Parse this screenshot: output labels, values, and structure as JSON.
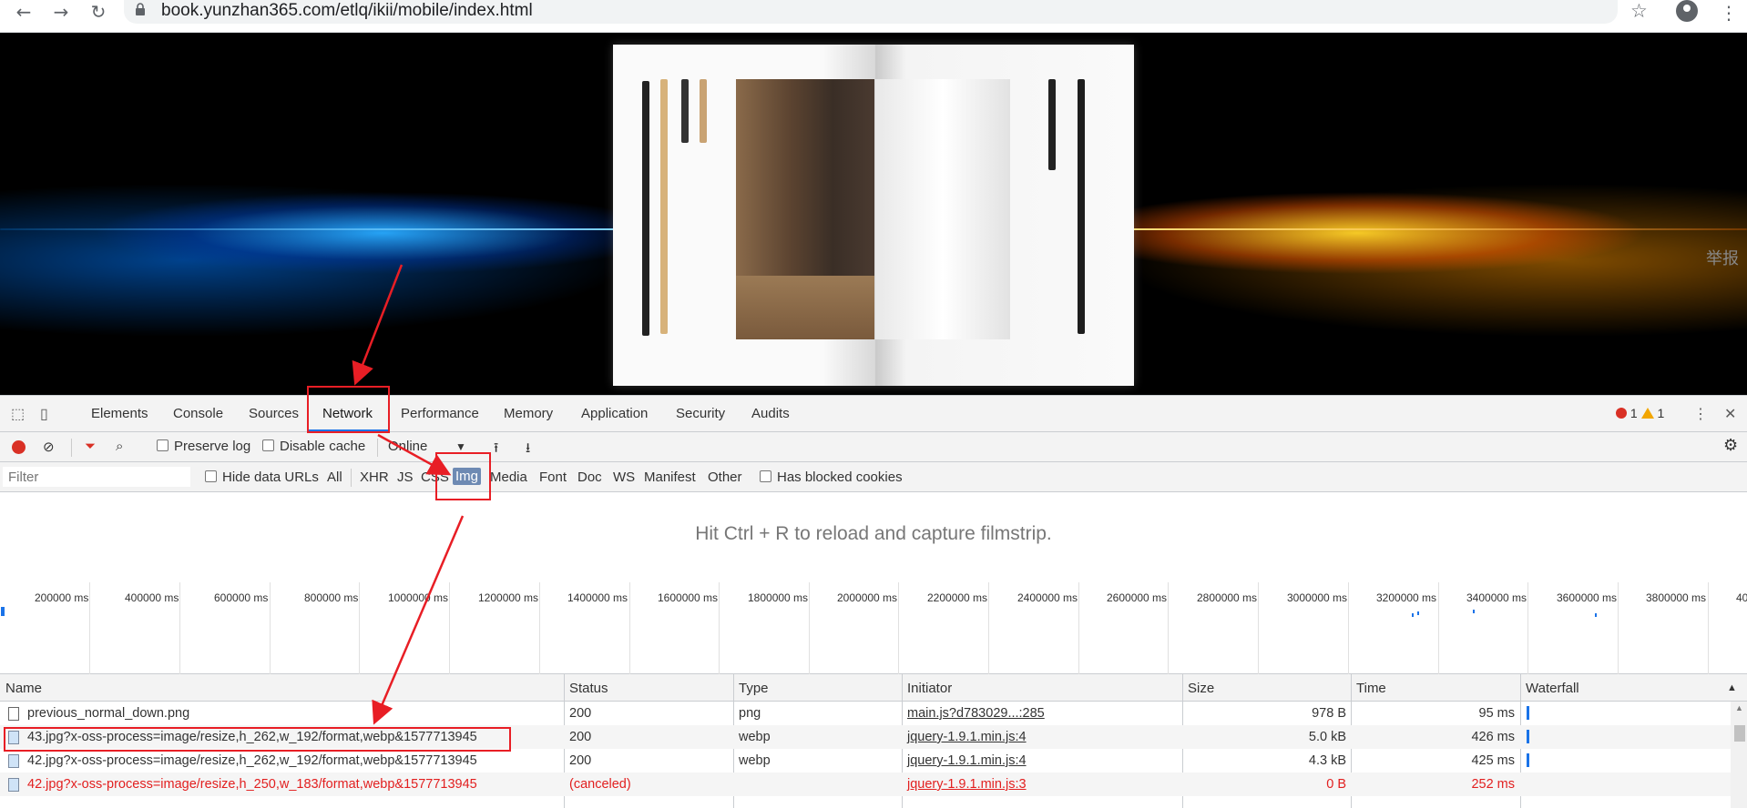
{
  "browser": {
    "url": "book.yunzhan365.com/etlq/ikii/mobile/index.html",
    "icons": [
      "back-icon",
      "forward-icon",
      "reload-icon",
      "lock-icon",
      "star-icon",
      "account-icon"
    ]
  },
  "page": {
    "report_label": "举报"
  },
  "devtools": {
    "tabs": [
      "Elements",
      "Console",
      "Sources",
      "Network",
      "Performance",
      "Memory",
      "Application",
      "Security",
      "Audits"
    ],
    "active_tab": "Network",
    "error_count": "1",
    "warning_count": "1",
    "toolbar": {
      "preserve_log": "Preserve log",
      "disable_cache": "Disable cache",
      "throttle": "Online"
    },
    "filter": {
      "placeholder": "Filter",
      "hide_data_urls": "Hide data URLs",
      "types": [
        "All",
        "XHR",
        "JS",
        "CSS",
        "Img",
        "Media",
        "Font",
        "Doc",
        "WS",
        "Manifest",
        "Other"
      ],
      "selected_type": "Img",
      "has_blocked_cookies": "Has blocked cookies"
    },
    "filmstrip_message": "Hit Ctrl + R to reload and capture filmstrip.",
    "timeline_ticks": [
      "200000 ms",
      "400000 ms",
      "600000 ms",
      "800000 ms",
      "1000000 ms",
      "1200000 ms",
      "1400000 ms",
      "1600000 ms",
      "1800000 ms",
      "2000000 ms",
      "2200000 ms",
      "2400000 ms",
      "2600000 ms",
      "2800000 ms",
      "3000000 ms",
      "3200000 ms",
      "3400000 ms",
      "3600000 ms",
      "3800000 ms",
      "40"
    ],
    "columns": [
      "Name",
      "Status",
      "Type",
      "Initiator",
      "Size",
      "Time",
      "Waterfall"
    ],
    "rows": [
      {
        "name": "previous_normal_down.png",
        "status": "200",
        "type": "png",
        "initiator": "main.js?d783029...:285",
        "size": "978 B",
        "time": "95 ms"
      },
      {
        "name": "43.jpg?x-oss-process=image/resize,h_262,w_192/format,webp&1577713945",
        "status": "200",
        "type": "webp",
        "initiator": "jquery-1.9.1.min.js:4",
        "size": "5.0 kB",
        "time": "426 ms"
      },
      {
        "name": "42.jpg?x-oss-process=image/resize,h_262,w_192/format,webp&1577713945",
        "status": "200",
        "type": "webp",
        "initiator": "jquery-1.9.1.min.js:4",
        "size": "4.3 kB",
        "time": "425 ms"
      },
      {
        "name": "42.jpg?x-oss-process=image/resize,h_250,w_183/format,webp&1577713945",
        "status": "(canceled)",
        "type": "",
        "initiator": "jquery-1.9.1.min.js:3",
        "size": "0 B",
        "time": "252 ms"
      }
    ]
  },
  "colors": {
    "annotation_red": "#e81e25",
    "error_red": "#e21f1f",
    "accent_blue": "#1a73e8"
  }
}
